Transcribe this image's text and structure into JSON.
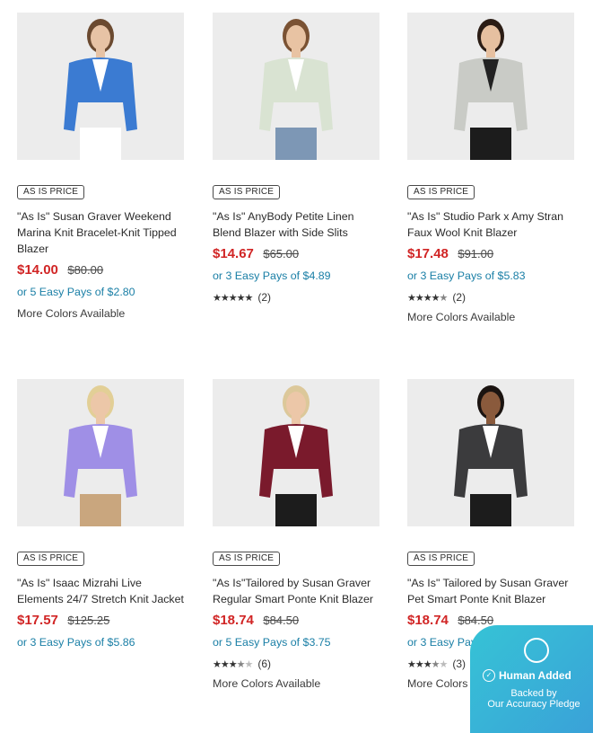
{
  "products": [
    {
      "badge": "AS IS PRICE",
      "title": "\"As Is\" Susan Graver Weekend Marina Knit Bracelet-Knit Tipped Blazer",
      "price": "$14.00",
      "was": "$80.00",
      "easy": "or 5 Easy Pays of $2.80",
      "rating": null,
      "reviews": "",
      "more": "More Colors Available",
      "jacket": "#3b7bd2",
      "trim": "#ffffff",
      "pants": "#ffffff",
      "hair": "#6b4a30",
      "skin": "#e7c3a5"
    },
    {
      "badge": "AS IS PRICE",
      "title": "\"As Is\" AnyBody Petite Linen Blend Blazer with Side Slits",
      "price": "$14.67",
      "was": "$65.00",
      "easy": "or 3 Easy Pays of $4.89",
      "rating": 5,
      "reviews": "(2)",
      "more": "",
      "jacket": "#d9e3d2",
      "trim": "#ffffff",
      "pants": "#7d97b5",
      "hair": "#7a5233",
      "skin": "#e8c3a3"
    },
    {
      "badge": "AS IS PRICE",
      "title": "\"As Is\" Studio Park x Amy Stran Faux Wool Knit Blazer",
      "price": "$17.48",
      "was": "$91.00",
      "easy": "or 3 Easy Pays of $5.83",
      "rating": 4.5,
      "reviews": "(2)",
      "more": "More Colors Available",
      "jacket": "#c9cbc6",
      "trim": "#222222",
      "pants": "#1c1c1c",
      "hair": "#2b1d15",
      "skin": "#e6c0a0"
    },
    {
      "badge": "AS IS PRICE",
      "title": "\"As Is\" Isaac Mizrahi Live Elements 24/7 Stretch Knit Jacket",
      "price": "$17.57",
      "was": "$125.25",
      "easy": "or 3 Easy Pays of $5.86",
      "rating": null,
      "reviews": "",
      "more": "",
      "jacket": "#9f8fe6",
      "trim": "#ffffff",
      "pants": "#c9a67e",
      "hair": "#e2cf96",
      "skin": "#ecc7a8"
    },
    {
      "badge": "AS IS PRICE",
      "title": "\"As Is\"Tailored by Susan Graver Regular Smart Ponte Knit Blazer",
      "price": "$18.74",
      "was": "$84.50",
      "easy": "or 5 Easy Pays of $3.75",
      "rating": 3.5,
      "reviews": "(6)",
      "more": "More Colors Available",
      "jacket": "#7a1a2c",
      "trim": "#ffffff",
      "pants": "#1c1c1c",
      "hair": "#dcc89a",
      "skin": "#ecc7a8"
    },
    {
      "badge": "AS IS PRICE",
      "title": "\"As Is\" Tailored by Susan Graver Pet Smart Ponte Knit Blazer",
      "price": "$18.74",
      "was": "$84.50",
      "easy": "or 3 Easy Pays of $6.25",
      "rating": 3.5,
      "reviews": "(3)",
      "more": "More Colors Available",
      "jacket": "#3b3b3d",
      "trim": "#ffffff",
      "pants": "#1c1c1c",
      "hair": "#1b1411",
      "skin": "#8a5a3c"
    }
  ],
  "pledge": {
    "line1": "Human Added",
    "line2": "Backed by",
    "line3": "Our Accuracy Pledge",
    "colors": {
      "bg": "#36c3d6"
    }
  },
  "colors": {
    "price": "#d12525",
    "easy": "#1a7fa6",
    "card_bg": "#ececec"
  }
}
